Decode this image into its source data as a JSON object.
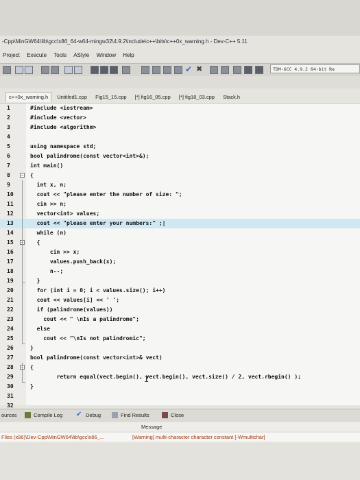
{
  "window": {
    "title": "-Cpp\\MinGW64\\lib\\gcc\\x86_64-w64-mingw32\\4.9.2\\include\\c++\\bits\\c++0x_warning.h - Dev-C++ 5.11"
  },
  "menubar": {
    "items": [
      "Project",
      "Execute",
      "Tools",
      "AStyle",
      "Window",
      "Help"
    ]
  },
  "toolbar": {
    "compiler": "TDM-GCC 4.9.2 64-bit Re"
  },
  "tabs": [
    {
      "label": "c++0x_warning.h",
      "active": true
    },
    {
      "label": "Untitled1.cpp"
    },
    {
      "label": "Fig15_15.cpp"
    },
    {
      "label": "[*] fig16_05.cpp"
    },
    {
      "label": "[*] fig18_03.cpp"
    },
    {
      "label": "Stack.h"
    }
  ],
  "code": [
    {
      "n": "1",
      "t": "#include <iostream>"
    },
    {
      "n": "2",
      "t": "#include <vector>"
    },
    {
      "n": "3",
      "t": "#include <algorithm>"
    },
    {
      "n": "4",
      "t": ""
    },
    {
      "n": "5",
      "t": "using namespace std;"
    },
    {
      "n": "6",
      "t": "bool palindrome(const vector<int>&);"
    },
    {
      "n": "7",
      "t": "int main()"
    },
    {
      "n": "8",
      "t": "{"
    },
    {
      "n": "9",
      "t": "  int x, n;"
    },
    {
      "n": "10",
      "t": "  cout << \"please enter the number of size: \";"
    },
    {
      "n": "11",
      "t": "  cin >> n;"
    },
    {
      "n": "12",
      "t": "  vector<int> values;"
    },
    {
      "n": "13",
      "t": "  cout << \"please enter your numbers:\" ;|"
    },
    {
      "n": "14",
      "t": "  while (n)"
    },
    {
      "n": "15",
      "t": "  {"
    },
    {
      "n": "16",
      "t": "      cin >> x;"
    },
    {
      "n": "17",
      "t": "      values.push_back(x);"
    },
    {
      "n": "18",
      "t": "      n--;"
    },
    {
      "n": "19",
      "t": "  }"
    },
    {
      "n": "20",
      "t": "  for (int i = 0; i < values.size(); i++)"
    },
    {
      "n": "21",
      "t": "  cout << values[i] << ' ';"
    },
    {
      "n": "22",
      "t": "  if (palindrome(values))"
    },
    {
      "n": "23",
      "t": "    cout << \" \\nIs a palindrome\";"
    },
    {
      "n": "24",
      "t": "  else"
    },
    {
      "n": "25",
      "t": "    cout << \"\\nIs not palindromic\";"
    },
    {
      "n": "26",
      "t": "}"
    },
    {
      "n": "27",
      "t": "bool palindrome(const vector<int>& vect)"
    },
    {
      "n": "28",
      "t": "{"
    },
    {
      "n": "29",
      "t": "        return equal(vect.begin(), vect.begin(), vect.size() / 2, vect.rbegin() );"
    },
    {
      "n": "30",
      "t": "}"
    },
    {
      "n": "31",
      "t": ""
    },
    {
      "n": "32",
      "t": ""
    }
  ],
  "statusbar": {
    "resources": "ources",
    "compile_log": "Compile Log",
    "debug": "Debug",
    "find_results": "Find Results",
    "close": "Close"
  },
  "messages": {
    "header": "Message",
    "row_file": "Files (x86)\\Dev-Cpp\\MinGW64\\lib\\gcc\\x86_...",
    "row_message": "[Warning] multi-character character constant [-Wmultichar]"
  },
  "colors": {
    "highlight": "#cfe8f4",
    "editor_bg": "#f6f6f4",
    "warning_text": "#a03c10"
  }
}
